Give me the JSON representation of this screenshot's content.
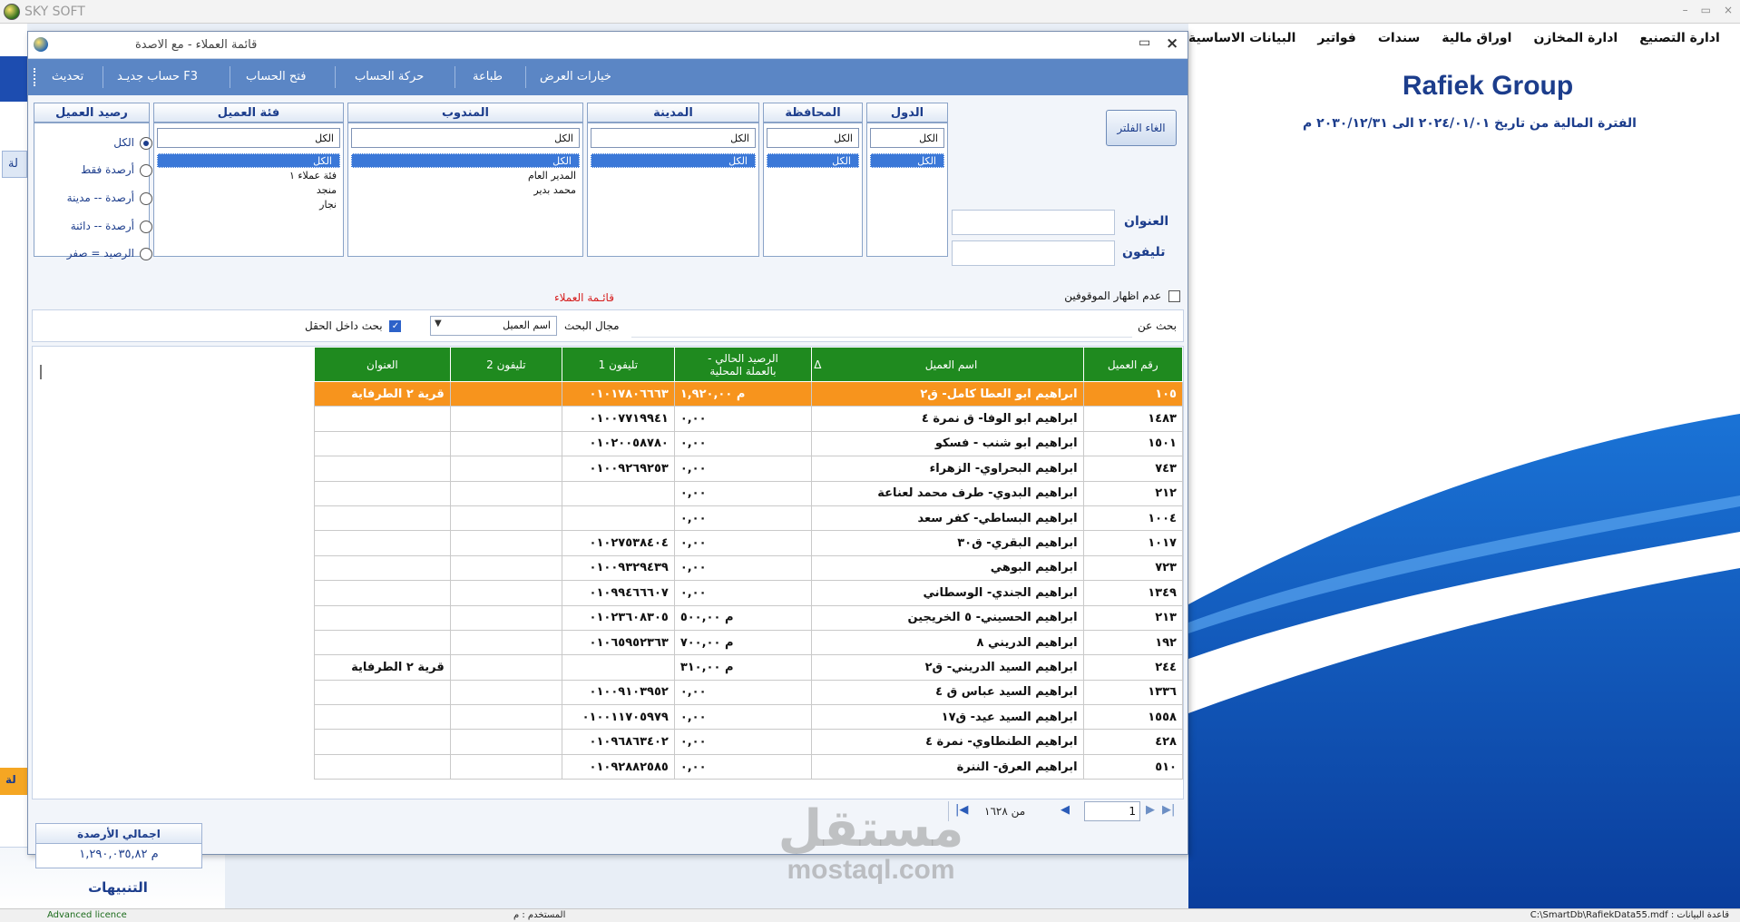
{
  "app": {
    "title": "SKY SOFT",
    "controls": [
      "–",
      "▭",
      "×"
    ]
  },
  "menu": [
    "البيانات الاساسية",
    "فواتير",
    "سندات",
    "اوراق مالية",
    "ادارة المخازن",
    "ادارة التصنيع"
  ],
  "company": {
    "name": "Rafiek Group",
    "period": "الفترة المالية من تاريخ ٢٠٢٤/٠١/٠١ الى ٢٠٣٠/١٢/٣١ م"
  },
  "left": {
    "tab1": "لة",
    "tab2": "لة",
    "alerts": "التنبيهات"
  },
  "status": {
    "licence": "Advanced licence",
    "user": "المستخدم :  م",
    "db": "قاعدة البيانات :   C:\\SmartDb\\RafiekData55.mdf"
  },
  "dialog": {
    "title": "قائمة العملاء  -  مع الاصدة",
    "toolbar": [
      "تحديث",
      "حساب جديـد F3",
      "فتح الحساب",
      "حركة الحساب",
      "طباعة",
      "خيارات العرض"
    ],
    "clear_filter": "الغاء الفلتر",
    "filters": {
      "countries": {
        "label": "الدول",
        "top": "الكل",
        "selected": "الكل",
        "items": []
      },
      "governorates": {
        "label": "المحافظة",
        "top": "الكل",
        "selected": "الكل",
        "items": []
      },
      "city": {
        "label": "المدينة",
        "top": "الكل",
        "selected": "الكل",
        "items": []
      },
      "rep": {
        "label": "المندوب",
        "top": "الكل",
        "selected": "الكل",
        "items": [
          "المدير العام",
          "محمد بدير"
        ]
      },
      "category": {
        "label": "فئة العميل",
        "top": "الكل",
        "selected": "الكل",
        "items": [
          "فئة عملاء ١",
          "منجد",
          "نجار"
        ]
      }
    },
    "balance_filter": {
      "label": "رصيد العميل",
      "options": [
        "الكل",
        "أرصدة فقط",
        "أرصدة -- مدينة",
        "أرصدة -- دائنة",
        "الرصيد = صفر"
      ],
      "selected_index": 0
    },
    "address_label": "العنوان",
    "phone_label": "تليفون",
    "hide_stopped": "عدم اظهار الموقوفين",
    "list_caption": "قائـمة العملاء",
    "search": {
      "label": "بحث عن",
      "value": "",
      "field_label": "مجال البحث",
      "field_value": "اسم العميل",
      "inside_label": "بحث داخل الحقل"
    },
    "grid": {
      "headers": [
        "رقم العميل",
        "اسم العميل",
        "Δ",
        "الرصيد الحالي -\nبالعملة المحلية",
        "تليفون 1",
        "تليفون 2",
        "العنوان"
      ],
      "rows": [
        [
          "١٠٥",
          "ابراهيم ابو العطا كامل- ق٢",
          "م ١,٩٢٠,٠٠",
          "٠١٠١٧٨٠٦٦٦٣",
          "",
          "قرية ٢ الطرفاية"
        ],
        [
          "١٤٨٣",
          "ابراهيم ابو الوفا- ق نمرة ٤",
          "٠,٠٠",
          "٠١٠٠٧٧١٩٩٤١",
          "",
          ""
        ],
        [
          "١٥٠١",
          "ابراهيم ابو شنب - فسكو",
          "٠,٠٠",
          "٠١٠٢٠٠٥٨٧٨٠",
          "",
          ""
        ],
        [
          "٧٤٣",
          "ابراهيم البحراوي- الزهراء",
          "٠,٠٠",
          "٠١٠٠٩٢٦٩٢٥٣",
          "",
          ""
        ],
        [
          "٢١٢",
          "ابراهيم البدوي- طرف محمد لعناعة",
          "٠,٠٠",
          "",
          "",
          ""
        ],
        [
          "١٠٠٤",
          "ابراهيم البساطي- كفر سعد",
          "٠,٠٠",
          "",
          "",
          ""
        ],
        [
          "١٠١٧",
          "ابراهيم البقري- ق٣٠",
          "٠,٠٠",
          "٠١٠٢٧٥٣٨٤٠٤",
          "",
          ""
        ],
        [
          "٧٢٣",
          "ابراهيم البوهي",
          "٠,٠٠",
          "٠١٠٠٩٣٢٩٤٣٩",
          "",
          ""
        ],
        [
          "١٣٤٩",
          "ابراهيم الجندي- الوسطاني",
          "٠,٠٠",
          "٠١٠٩٩٤٦٦٦٠٧",
          "",
          ""
        ],
        [
          "٢١٣",
          "ابراهيم الحسيني- ٥ الخريجين",
          "م ٥٠٠,٠٠",
          "٠١٠٢٣٦٠٨٣٠٥",
          "",
          ""
        ],
        [
          "١٩٢",
          "ابراهيم الدريني ٨",
          "م ٧٠٠,٠٠",
          "٠١٠٦٥٩٥٢٣٦٣",
          "",
          ""
        ],
        [
          "٢٤٤",
          "ابراهيم السيد الدريني- ق٢",
          "م ٣١٠,٠٠",
          "",
          "",
          "قرية ٢ الطرفاية"
        ],
        [
          "١٣٣٦",
          "ابراهيم السيد عباس ق ٤",
          "٠,٠٠",
          "٠١٠٠٩١٠٣٩٥٢",
          "",
          ""
        ],
        [
          "١٥٥٨",
          "ابراهيم السيد عيد- ق١٧",
          "٠,٠٠",
          "٠١٠٠١١٧٠٥٩٧٩",
          "",
          ""
        ],
        [
          "٤٢٨",
          "ابراهيم الطنطاوي- نمرة ٤",
          "٠,٠٠",
          "٠١٠٩٦٨٦٣٤٠٢",
          "",
          ""
        ],
        [
          "٥١٠",
          "ابراهيم العرق- الننرة",
          "٠,٠٠",
          "٠١٠٩٢٨٨٢٥٨٥",
          "",
          ""
        ]
      ],
      "selected_row": 0
    },
    "pager": {
      "page": "1",
      "of": "من ١٦٢٨"
    },
    "totals": {
      "label": "اجمالي الأرصدة",
      "value": "م ١,٢٩٠,٠٣٥,٨٢"
    }
  },
  "watermark": {
    "ar": "مستقل",
    "en": "mostaql.com"
  },
  "colors": {
    "toolbar": "#5b86c5",
    "grid_header": "#1f8a1f",
    "selected_row": "#f7941d",
    "accent_blue": "#1c3d8c"
  }
}
